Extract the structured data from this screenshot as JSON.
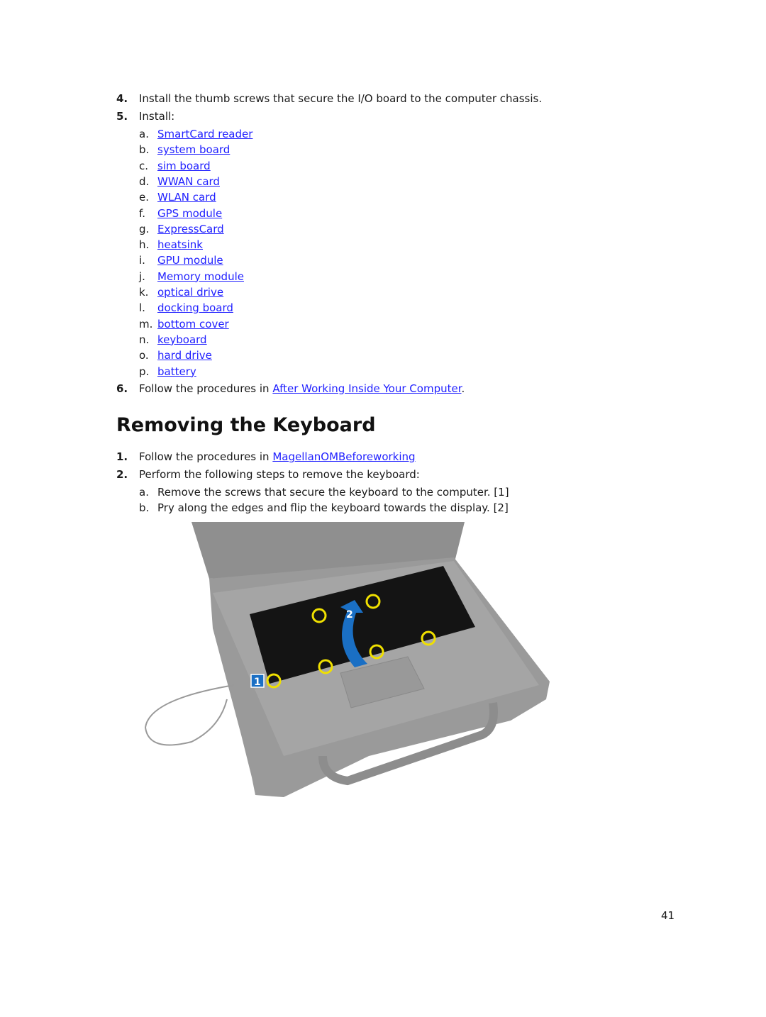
{
  "steps_top": [
    {
      "num": "4.",
      "text": "Install the thumb screws that secure the I/O board to the computer chassis."
    },
    {
      "num": "5.",
      "text": "Install:"
    }
  ],
  "install_items": [
    {
      "letter": "a.",
      "link": "SmartCard reader"
    },
    {
      "letter": "b.",
      "link": "system board"
    },
    {
      "letter": "c.",
      "link": "sim board"
    },
    {
      "letter": "d.",
      "link": "WWAN card"
    },
    {
      "letter": "e.",
      "link": "WLAN card"
    },
    {
      "letter": "f.",
      "link": "GPS module"
    },
    {
      "letter": "g.",
      "link": "ExpressCard"
    },
    {
      "letter": "h.",
      "link": "heatsink"
    },
    {
      "letter": "i.",
      "link": "GPU module"
    },
    {
      "letter": "j.",
      "link": "Memory module"
    },
    {
      "letter": "k.",
      "link": "optical drive"
    },
    {
      "letter": "l.",
      "link": "docking board"
    },
    {
      "letter": "m.",
      "link": "bottom cover"
    },
    {
      "letter": "n.",
      "link": "keyboard"
    },
    {
      "letter": "o.",
      "link": "hard drive"
    },
    {
      "letter": "p.",
      "link": "battery"
    }
  ],
  "step6": {
    "num": "6.",
    "text": "Follow the procedures in ",
    "link": "After Working Inside Your Computer",
    "after": "."
  },
  "section": {
    "title": "Removing the Keyboard",
    "step1": {
      "num": "1.",
      "text": "Follow the procedures in ",
      "link": "MagellanOMBeforeworking"
    },
    "step2": {
      "num": "2.",
      "text": "Perform the following steps to remove the keyboard:"
    },
    "substeps": [
      {
        "letter": "a.",
        "text": "Remove the screws that secure the keyboard to the computer. [1]"
      },
      {
        "letter": "b.",
        "text": "Pry along the edges and flip the keyboard towards the display. [2]"
      }
    ]
  },
  "figure": {
    "callout1": "1",
    "callout2": "2",
    "screw_color": "#f0e000",
    "callout_color": "#1a6fc4"
  },
  "page_number": "41",
  "colors": {
    "link": "#1f1fff"
  }
}
